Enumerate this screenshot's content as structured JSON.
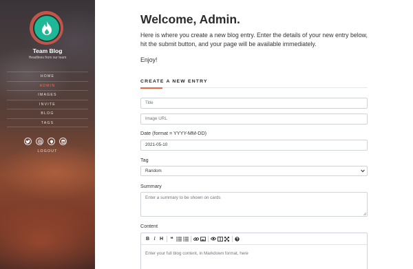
{
  "sidebar": {
    "brand": "Team Blog",
    "tagline": "Headlines from our team",
    "nav": [
      {
        "label": "HOME",
        "active": false
      },
      {
        "label": "ADMIN",
        "active": true
      },
      {
        "label": "IMAGES",
        "active": false
      },
      {
        "label": "INVITE",
        "active": false
      },
      {
        "label": "BLOG",
        "active": false
      },
      {
        "label": "TAGS",
        "active": false
      }
    ],
    "socials": [
      "twitter-icon",
      "instagram-icon",
      "github-icon",
      "linkedin-icon"
    ],
    "logout": "LOGOUT"
  },
  "main": {
    "title": "Welcome, Admin.",
    "intro": "Here is where you create a new blog entry. Enter the details of your new entry below, hit the submit button, and your page will be available immediately.",
    "enjoy": "Enjoy!",
    "section_title": "CREATE A NEW ENTRY"
  },
  "form": {
    "title_placeholder": "Title",
    "image_placeholder": "Image URL",
    "date_label": "Date (format = YYYY-MM-DD)",
    "date_value": "2021-05-10",
    "tag_label": "Tag",
    "tag_value": "Random",
    "summary_label": "Summary",
    "summary_placeholder": "Enter a summary to be shown on cards",
    "content_label": "Content",
    "content_placeholder": "Enter your full blog content, in Markdown format, here"
  },
  "toolbar": {
    "bold": "B",
    "italic": "I",
    "heading": "H",
    "quote": "❝"
  },
  "colors": {
    "accent": "#e8643c",
    "logo_ring": "#c2544a",
    "logo_fill": "#1fb897"
  }
}
